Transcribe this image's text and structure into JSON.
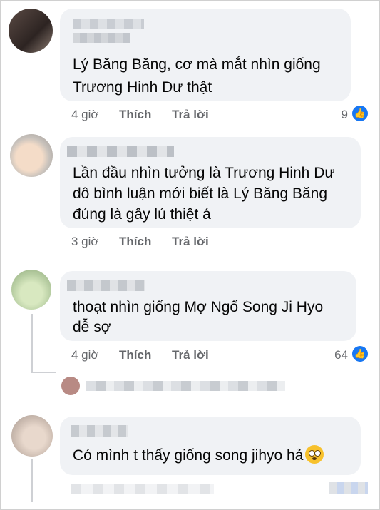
{
  "comments": [
    {
      "lines": [
        "Lý Băng Băng, cơ mà mắt nhìn giống",
        "Trương Hinh Dư thật"
      ],
      "time": "4 giờ",
      "like_label": "Thích",
      "reply_label": "Trả lời",
      "reaction_count": "9"
    },
    {
      "lines": [
        "Lần đầu nhìn tưởng là Trương Hinh Dư",
        "dô bình luận mới biết là Lý Băng Băng",
        "đúng là gây lú thiệt á"
      ],
      "time": "3 giờ",
      "like_label": "Thích",
      "reply_label": "Trả lời"
    },
    {
      "lines": [
        "thoạt nhìn giống Mợ Ngố Song Ji Hyo",
        "dễ sợ"
      ],
      "time": "4 giờ",
      "like_label": "Thích",
      "reply_label": "Trả lời",
      "reaction_count": "64"
    },
    {
      "lines": [
        "Có mình t thấy giống song jihyo hả"
      ],
      "emoji": "flushed-face"
    }
  ],
  "reaction_icon": "thumbs-up-icon",
  "colors": {
    "bubble": "#f0f2f5",
    "meta": "#65676b",
    "like_blue": "#1877f2",
    "thread_line": "#ced0d4"
  }
}
